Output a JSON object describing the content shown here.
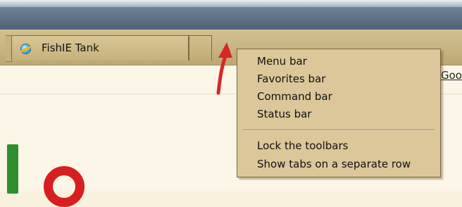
{
  "tab": {
    "label": "FishIE Tank",
    "icon": "ie-globe-icon"
  },
  "context_menu": {
    "items": [
      "Menu bar",
      "Favorites bar",
      "Command bar",
      "Status bar",
      "Lock the toolbars",
      "Show tabs on a separate row"
    ]
  },
  "page": {
    "link_fragment": "Goo"
  },
  "colors": {
    "chrome_tan": "#c8b583",
    "menu_background": "#dcc79a",
    "annotation_arrow": "#d72626"
  }
}
